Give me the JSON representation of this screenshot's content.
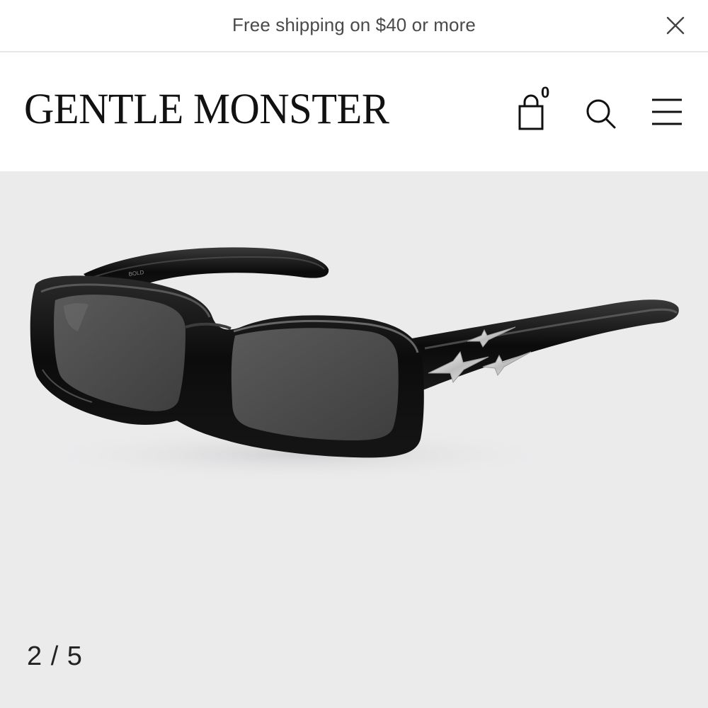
{
  "announcement": {
    "text": "Free shipping on $40 or more",
    "close_icon": "close-icon"
  },
  "header": {
    "logo_text": "GENTLE MONSTER",
    "cart_count": "0",
    "cart_icon": "shopping-bag-icon",
    "search_icon": "search-icon",
    "menu_icon": "hamburger-menu-icon"
  },
  "gallery": {
    "image_description_name": "product-sunglasses-image",
    "current_slide": "2 / 5",
    "background_color": "#ebebec",
    "frame_color": "#111111",
    "lens_color": "#4a4a4a",
    "accent_color": "#c9c9c9"
  },
  "colors": {
    "text_primary": "#111111",
    "text_secondary": "#4a4a4a",
    "divider": "#e7e7e7"
  }
}
